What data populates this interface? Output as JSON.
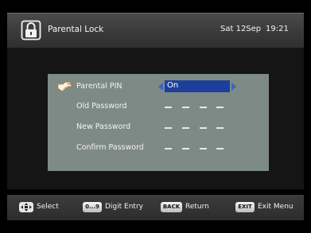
{
  "header": {
    "title": "Parental Lock",
    "date": "Sat 12Sep",
    "time": "19:21",
    "icon": "lock-icon"
  },
  "settings": {
    "parental_pin": {
      "label": "Parental PIN",
      "value": "On"
    },
    "old_password": {
      "label": "Old Password"
    },
    "new_password": {
      "label": "New Password"
    },
    "confirm_password": {
      "label": "Confirm Password"
    }
  },
  "footer": {
    "select": {
      "key": "",
      "label": "Select"
    },
    "digit": {
      "key": "0...9",
      "label": "Digit Entry"
    },
    "back": {
      "key": "BACK",
      "label": "Return"
    },
    "exit": {
      "key": "EXIT",
      "label": "Exit Menu"
    }
  },
  "colors": {
    "panel": "#7e8a86",
    "highlight": "#1d3f9c",
    "arrow": "#3a63c8"
  }
}
